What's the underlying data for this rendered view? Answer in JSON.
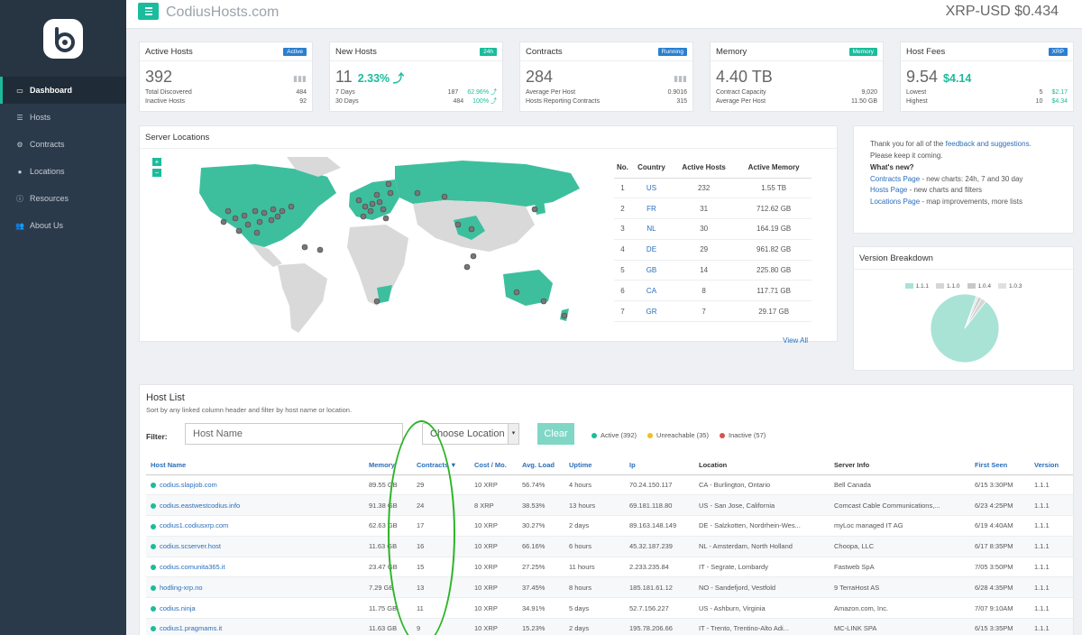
{
  "header": {
    "site_title": "CodiusHosts.com",
    "price": "XRP-USD $0.434"
  },
  "sidebar": {
    "items": [
      {
        "label": "Dashboard",
        "icon": "laptop-icon"
      },
      {
        "label": "Hosts",
        "icon": "server-icon"
      },
      {
        "label": "Contracts",
        "icon": "gears-icon"
      },
      {
        "label": "Locations",
        "icon": "globe-icon"
      },
      {
        "label": "Resources",
        "icon": "info-icon"
      },
      {
        "label": "About Us",
        "icon": "users-icon"
      }
    ]
  },
  "stats": {
    "active_hosts": {
      "title": "Active Hosts",
      "badge": "Active",
      "value": "392",
      "row1_label": "Total Discovered",
      "row1_value": "484",
      "row2_label": "Inactive Hosts",
      "row2_value": "92"
    },
    "new_hosts": {
      "title": "New Hosts",
      "badge": "24h",
      "value": "11",
      "delta": "2.33% ⤴",
      "row1_label": "7 Days",
      "row1_value": "187",
      "row1_pct": "62.96% ⤴",
      "row2_label": "30 Days",
      "row2_value": "484",
      "row2_pct": "100% ⤴"
    },
    "contracts": {
      "title": "Contracts",
      "badge": "Running",
      "value": "284",
      "row1_label": "Average Per Host",
      "row1_value": "0.9016",
      "row2_label": "Hosts Reporting Contracts",
      "row2_value": "315"
    },
    "memory": {
      "title": "Memory",
      "badge": "Memory",
      "value": "4.40 TB",
      "row1_label": "Contract Capacity",
      "row1_value": "9,020",
      "row2_label": "Average Per Host",
      "row2_value": "11.50 GB"
    },
    "host_fees": {
      "title": "Host Fees",
      "badge": "XRP",
      "value": "9.54",
      "delta": "$4.14",
      "row1_label": "Lowest",
      "row1_value": "5",
      "row1_usd": "$2.17",
      "row2_label": "Highest",
      "row2_value": "10",
      "row2_usd": "$4.34"
    }
  },
  "colors": {
    "accent": "#1abc9c",
    "active_badge": "#2a7fcf",
    "new_badge": "#1abc9c",
    "running_badge": "#2a7fcf",
    "memory_badge": "#1abc9c",
    "xrp_badge": "#2a7fcf",
    "link": "#2a6ebb",
    "unreachable": "#f0c020",
    "inactive": "#d9534f"
  },
  "server_locations": {
    "title": "Server Locations",
    "zoom_in": "+",
    "zoom_out": "−",
    "columns": [
      "No.",
      "Country",
      "Active Hosts",
      "Active Memory"
    ],
    "rows": [
      [
        "1",
        "US",
        "232",
        "1.55 TB"
      ],
      [
        "2",
        "FR",
        "31",
        "712.62 GB"
      ],
      [
        "3",
        "NL",
        "30",
        "164.19 GB"
      ],
      [
        "4",
        "DE",
        "29",
        "961.82 GB"
      ],
      [
        "5",
        "GB",
        "14",
        "225.80 GB"
      ],
      [
        "6",
        "CA",
        "8",
        "117.71 GB"
      ],
      [
        "7",
        "GR",
        "7",
        "29.17 GB"
      ]
    ],
    "view_all": "View All"
  },
  "info": {
    "thanks_pre": "Thank you for all of the ",
    "thanks_link": "feedback and suggestions",
    "thanks_post": ".",
    "keep": "Please keep it coming.",
    "whats_new": "What's new?",
    "items": [
      {
        "link": "Contracts Page",
        "text": " - new charts: 24h, 7 and 30 day"
      },
      {
        "link": "Hosts Page",
        "text": " - new charts and filters"
      },
      {
        "link": "Locations Page",
        "text": " - map improvements, more lists"
      }
    ]
  },
  "version": {
    "title": "Version Breakdown",
    "legend": [
      {
        "label": "1.1.1",
        "color": "#a8e3d6"
      },
      {
        "label": "1.1.0",
        "color": "#d6d6d6"
      },
      {
        "label": "1.0.4",
        "color": "#c8c8c8"
      },
      {
        "label": "1.0.3",
        "color": "#e0e0e0"
      }
    ]
  },
  "chart_data": {
    "type": "pie",
    "title": "Version Breakdown",
    "categories": [
      "1.1.1",
      "1.1.0",
      "1.0.4",
      "1.0.3"
    ],
    "values": [
      95,
      2.5,
      1.5,
      1
    ]
  },
  "host_list": {
    "title": "Host List",
    "subtitle": "Sort by any linked column header and filter by host name or location.",
    "filter_label": "Filter:",
    "host_placeholder": "Host Name",
    "location_placeholder": "Choose Location",
    "clear_label": "Clear",
    "legend": {
      "active": "Active (392)",
      "unreachable": "Unreachable (35)",
      "inactive": "Inactive (57)"
    },
    "columns": [
      "Host Name",
      "Memory",
      "Contracts ▼",
      "Cost / Mo.",
      "Avg. Load",
      "Uptime",
      "Ip",
      "Location",
      "Server Info",
      "First Seen",
      "Version"
    ],
    "rows": [
      [
        "codius.slapjob.com",
        "89.55 GB",
        "29",
        "10 XRP",
        "56.74%",
        "4 hours",
        "70.24.150.117",
        "CA - Burlington, Ontario",
        "Bell Canada",
        "6/15 3:30PM",
        "1.1.1"
      ],
      [
        "codius.eastwestcodius.info",
        "91.38 GB",
        "24",
        "8 XRP",
        "38.53%",
        "13 hours",
        "69.181.118.80",
        "US - San Jose, California",
        "Comcast Cable Communications,...",
        "6/23 4:25PM",
        "1.1.1"
      ],
      [
        "codius1.codiusxrp.com",
        "62.63 GB",
        "17",
        "10 XRP",
        "30.27%",
        "2 days",
        "89.163.148.149",
        "DE - Salzkotten, Nordrhein-Wes...",
        "myLoc managed IT AG",
        "6/19 4:40AM",
        "1.1.1"
      ],
      [
        "codius.scserver.host",
        "11.63 GB",
        "16",
        "10 XRP",
        "66.16%",
        "6 hours",
        "45.32.187.239",
        "NL - Amsterdam, North Holland",
        "Choopa, LLC",
        "6/17 8:35PM",
        "1.1.1"
      ],
      [
        "codius.comunita365.it",
        "23.47 GB",
        "15",
        "10 XRP",
        "27.25%",
        "11 hours",
        "2.233.235.84",
        "IT - Segrate, Lombardy",
        "Fastweb SpA",
        "7/05 3:50PM",
        "1.1.1"
      ],
      [
        "hodling-xrp.no",
        "7.29 GB",
        "13",
        "10 XRP",
        "37.45%",
        "8 hours",
        "185.181.61.12",
        "NO - Sandefjord, Vestfold",
        "9 TerraHost AS",
        "6/28 4:35PM",
        "1.1.1"
      ],
      [
        "codius.ninja",
        "11.75 GB",
        "11",
        "10 XRP",
        "34.91%",
        "5 days",
        "52.7.156.227",
        "US - Ashburn, Virginia",
        "Amazon.com, Inc.",
        "7/07 9:10AM",
        "1.1.1"
      ],
      [
        "codius1.pragmams.it",
        "11.63 GB",
        "9",
        "10 XRP",
        "15.23%",
        "2 days",
        "195.78.206.66",
        "IT - Trento, Trentino-Alto Adi...",
        "MC-LINK SPA",
        "6/15 3:35PM",
        "1.1.1"
      ]
    ]
  }
}
